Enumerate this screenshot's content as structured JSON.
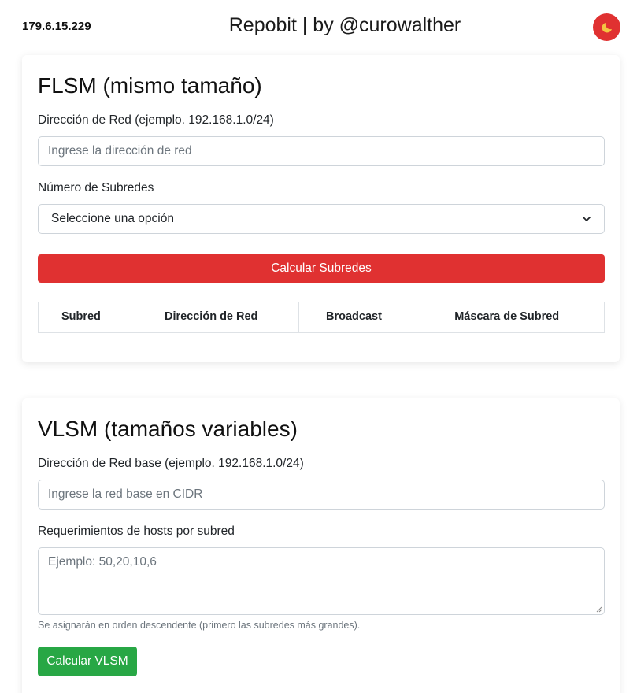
{
  "header": {
    "ip_address": "179.6.15.229",
    "brand": "Repobit | by @curowalther",
    "theme_toggle_icon": "moon-icon"
  },
  "flsm": {
    "title": "FLSM (mismo tamaño)",
    "network_label": "Dirección de Red (ejemplo. 192.168.1.0/24)",
    "network_placeholder": "Ingrese la dirección de red",
    "network_value": "",
    "subnets_label": "Número de Subredes",
    "subnets_selected": "Seleccione una opción",
    "calc_button": "Calcular Subredes",
    "table_headers": [
      "Subred",
      "Dirección de Red",
      "Broadcast",
      "Máscara de Subred"
    ]
  },
  "vlsm": {
    "title": "VLSM (tamaños variables)",
    "base_label": "Dirección de Red base (ejemplo. 192.168.1.0/24)",
    "base_placeholder": "Ingrese la red base en CIDR",
    "base_value": "",
    "hosts_label": "Requerimientos de hosts por subred",
    "hosts_placeholder": "Ejemplo: 50,20,10,6",
    "hosts_value": "",
    "hint": "Se asignarán en orden descendente (primero las subredes más grandes).",
    "calc_button": "Calcular VLSM"
  },
  "colors": {
    "primary_red": "#e03131",
    "success_green": "#28a745"
  }
}
